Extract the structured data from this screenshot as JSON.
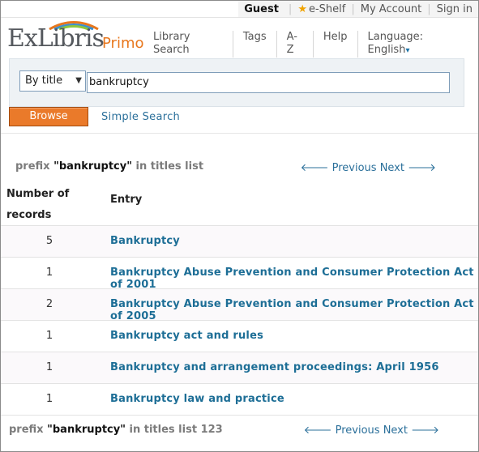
{
  "userbar": {
    "guest": "Guest",
    "eshelf": "e-Shelf",
    "my_account": "My Account",
    "sign_in": "Sign in"
  },
  "header": {
    "logo_ex": "ExLibris",
    "logo_primo": "Primo",
    "nav": [
      "Library Search",
      "Tags",
      "A-Z",
      "Help"
    ],
    "language_label": "Language:",
    "language_value": "English"
  },
  "search": {
    "type_value": "By title",
    "query": "bankruptcy",
    "browse_label": "Browse",
    "simple_search": "Simple Search"
  },
  "results": {
    "prefix_label": "prefix",
    "prefix_term": "\"bankruptcy\"",
    "prefix_suffix_top": "in titles list",
    "prefix_suffix_bottom": "in titles list 123",
    "previous": "Previous",
    "next": "Next",
    "col_num_line1": "Number of",
    "col_num_line2": "records",
    "col_entry": "Entry",
    "rows": [
      {
        "count": "5",
        "entry": "Bankruptcy"
      },
      {
        "count": "1",
        "entry": "Bankruptcy Abuse Prevention and Consumer Protection Act of 2001"
      },
      {
        "count": "2",
        "entry": "Bankruptcy Abuse Prevention and Consumer Protection Act of 2005"
      },
      {
        "count": "1",
        "entry": "Bankruptcy act and rules"
      },
      {
        "count": "1",
        "entry": "Bankruptcy and arrangement proceedings: April 1956"
      },
      {
        "count": "1",
        "entry": "Bankruptcy law and practice"
      }
    ]
  },
  "colors": {
    "accent_orange": "#ea7a2a",
    "link_blue": "#1d6e96"
  }
}
